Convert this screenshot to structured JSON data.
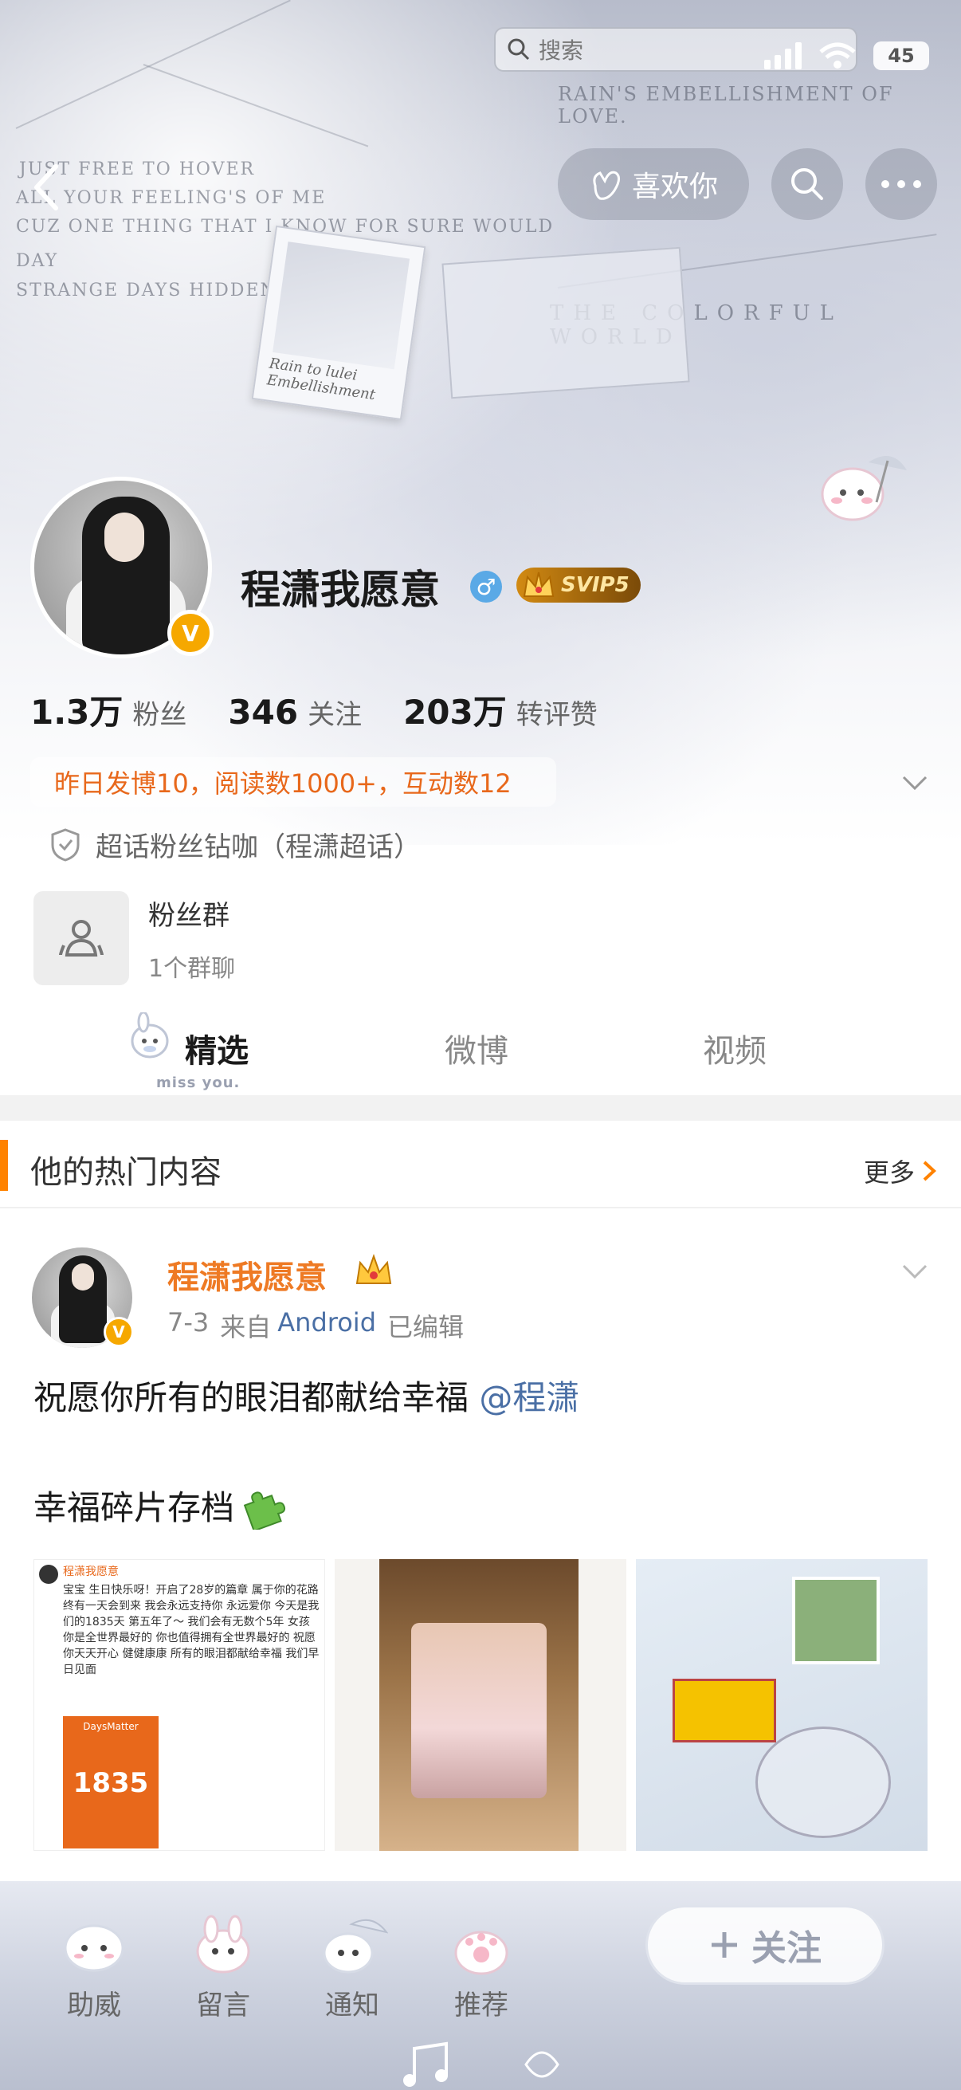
{
  "status_bar": {
    "battery": "45"
  },
  "search": {
    "placeholder": "搜索"
  },
  "header": {
    "like_label": "喜欢你",
    "banner_text": {
      "line1": "RAIN'S EMBELLISHMENT OF LOVE.",
      "line2": "THE COLORFUL WORLD",
      "left1": "JUST FREE TO HOVER",
      "left2": "ALL YOUR FEELING'S OF ME",
      "left3": "CUZ ONE THING THAT I KNOW FOR SURE WOULD",
      "left4": "DAY",
      "left5": "STRANGE DAYS HIDDEN",
      "polaroid": "Rain to lulei Embellishment"
    }
  },
  "profile": {
    "name": "程潇我愿意",
    "gender": "♂",
    "svip": "SVIP5",
    "verified": "V",
    "stats": [
      {
        "num": "1.3万",
        "label": "粉丝"
      },
      {
        "num": "346",
        "label": "关注"
      },
      {
        "num": "203万",
        "label": "转评赞"
      }
    ],
    "daily": "昨日发博10，阅读数1000+，互动数12",
    "supertopic": "超话粉丝钻咖（程潇超话）",
    "fan_group": {
      "title": "粉丝群",
      "subtitle": "1个群聊"
    }
  },
  "tabs": {
    "featured": "精选",
    "weibo": "微博",
    "video": "视频",
    "mascot_text": "miss you."
  },
  "hot": {
    "title": "他的热门内容",
    "more": "更多"
  },
  "post": {
    "author": "程潇我愿意",
    "date": "7-3",
    "source_prefix": "来自",
    "source": "Android",
    "edited": "已编辑",
    "text": "祝愿你所有的眼泪都献给幸福",
    "mention": "@程潇",
    "subtext": "幸福碎片存档",
    "thumb1": {
      "author": "程潇我愿意",
      "body": "宝宝 生日快乐呀！开启了28岁的篇章 属于你的花路终有一天会到来 我会永远支持你 永远爱你 今天是我们的1835天 第五年了～ 我们会有无数个5年 女孩 你是全世界最好的 你也值得拥有全世界最好的 祝愿你天天开心 健健康康 所有的眼泪都献给幸福 我们早日见面",
      "card_title": "DaysMatter",
      "card_num": "1835"
    }
  },
  "bottom_nav": {
    "items": [
      "助威",
      "留言",
      "通知",
      "推荐"
    ],
    "follow": "关注"
  },
  "colors": {
    "accent": "#ff8200",
    "orange_text": "#e8681b",
    "link": "#4a6fa5"
  }
}
